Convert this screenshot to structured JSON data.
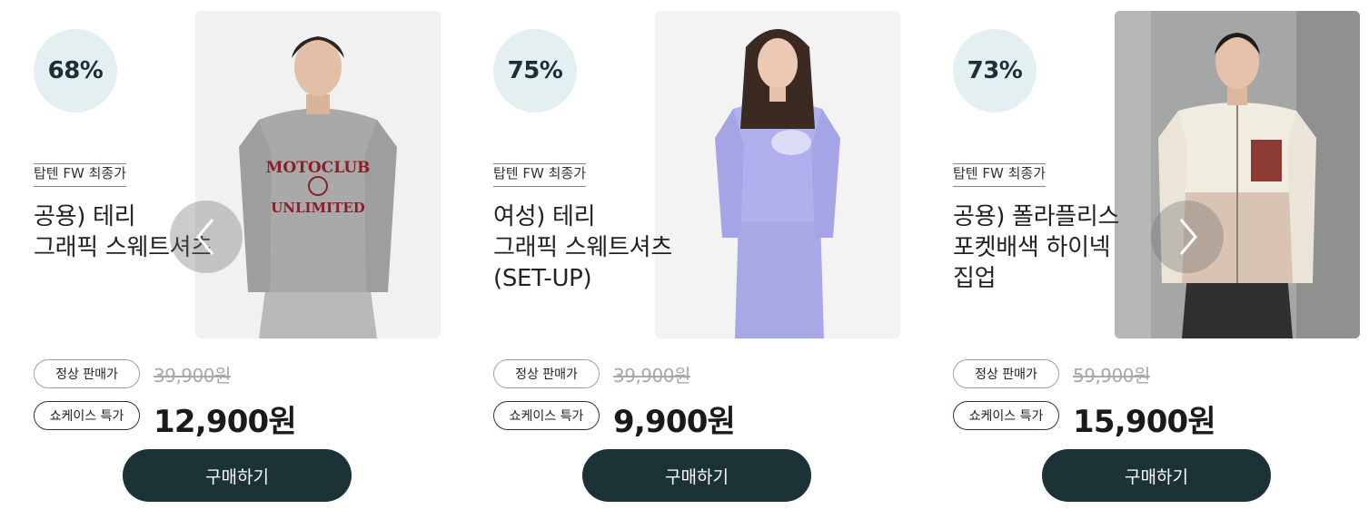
{
  "products": [
    {
      "discount": "68%",
      "tag": "탑텐 FW 최종가",
      "name": "공용) 테리\n그래픽 스웨트셔츠",
      "normal_label": "정상 판매가",
      "original_price": "39,900원",
      "special_label": "쇼케이스 특가",
      "sale_price": "12,900원",
      "buy_label": "구매하기",
      "photo_icon": "model-gray-sweatshirt-image",
      "graphic_text_top": "MOTOCLUB",
      "graphic_text_bottom": "UNLIMITED"
    },
    {
      "discount": "75%",
      "tag": "탑텐 FW 최종가",
      "name": "여성) 테리\n그래픽 스웨트셔츠\n(SET-UP)",
      "normal_label": "정상 판매가",
      "original_price": "39,900원",
      "special_label": "쇼케이스 특가",
      "sale_price": "9,900원",
      "buy_label": "구매하기",
      "photo_icon": "model-lavender-setup-image"
    },
    {
      "discount": "73%",
      "tag": "탑텐 FW 최종가",
      "name": "공용) 폴라플리스\n포켓배색 하이넥\n집업",
      "normal_label": "정상 판매가",
      "original_price": "59,900원",
      "special_label": "쇼케이스 특가",
      "sale_price": "15,900원",
      "buy_label": "구매하기",
      "photo_icon": "model-fleece-zipup-image"
    }
  ],
  "nav": {
    "prev_icon": "chevron-left-icon",
    "next_icon": "chevron-right-icon"
  },
  "colors": {
    "accent": "#1b3337",
    "badge_bg": "#e4eff1",
    "strike": "#a8a8a8"
  }
}
